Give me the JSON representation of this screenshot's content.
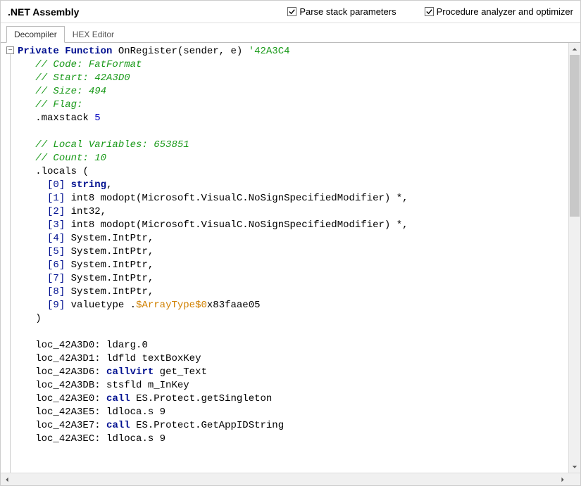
{
  "header": {
    "title": ".NET Assembly",
    "checkboxes": {
      "parse_stack": {
        "label": "Parse stack parameters",
        "checked": true
      },
      "proc_analyzer": {
        "label": "Procedure analyzer and optimizer",
        "checked": true
      }
    }
  },
  "tabs": {
    "decompiler": "Decompiler",
    "hex": "HEX Editor",
    "active": "decompiler"
  },
  "code": {
    "sig_kw1": "Private",
    "sig_kw2": "Function",
    "sig_name": "OnRegister",
    "sig_params": "(sender, e)",
    "sig_addr": "'42A3C4",
    "c_format": "// Code: FatFormat",
    "c_start": "// Start: 42A3D0",
    "c_size": "// Size: 494",
    "c_flag": "// Flag:",
    "maxstack_kw": ".maxstack",
    "maxstack_val": "5",
    "c_locals": "// Local Variables: 653851",
    "c_count": "// Count: 10",
    "locals_kw": ".locals",
    "locals_open": "(",
    "loc0_idx": "[0]",
    "loc0_type": "string",
    "loc1_idx": "[1]",
    "loc1_type": "int8 modopt(Microsoft.VisualC.NoSignSpecifiedModifier) *,",
    "loc2_idx": "[2]",
    "loc2_type": "int32,",
    "loc3_idx": "[3]",
    "loc3_type": "int8 modopt(Microsoft.VisualC.NoSignSpecifiedModifier) *,",
    "loc4_idx": "[4]",
    "loc4_type": "System.IntPtr,",
    "loc5_idx": "[5]",
    "loc5_type": "System.IntPtr,",
    "loc6_idx": "[6]",
    "loc6_type": "System.IntPtr,",
    "loc7_idx": "[7]",
    "loc7_type": "System.IntPtr,",
    "loc8_idx": "[8]",
    "loc8_type": "System.IntPtr,",
    "loc9_idx": "[9]",
    "loc9_type_a": "valuetype .",
    "loc9_type_b": "$ArrayType$0",
    "loc9_type_c": "x83faae05",
    "locals_close": ")",
    "i0_addr": "loc_42A3D0:",
    "i0_op": "ldarg.0",
    "i1_addr": "loc_42A3D1:",
    "i1_op": "ldfld textBoxKey",
    "i2_addr": "loc_42A3D6:",
    "i2_op": "callvirt",
    "i2_ar": "get_Text",
    "i3_addr": "loc_42A3DB:",
    "i3_op": "stsfld m_InKey",
    "i4_addr": "loc_42A3E0:",
    "i4_op": "call",
    "i4_ar": "ES.Protect.getSingleton",
    "i5_addr": "loc_42A3E5:",
    "i5_op": "ldloca.s 9",
    "i6_addr": "loc_42A3E7:",
    "i6_op": "call",
    "i6_ar": "ES.Protect.GetAppIDString",
    "i7_addr": "loc_42A3EC:",
    "i7_op": "ldloca.s 9"
  }
}
